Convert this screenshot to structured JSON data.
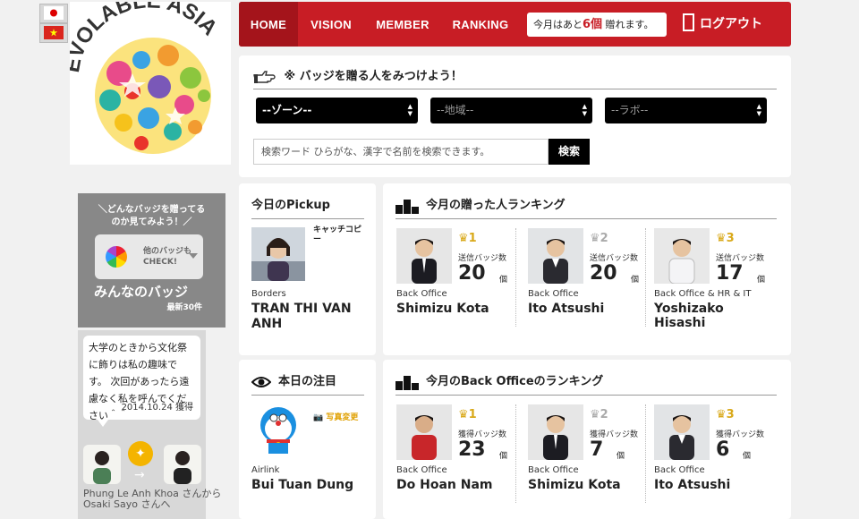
{
  "languages": [
    "Japanese",
    "Vietnamese"
  ],
  "logo": {
    "text": "EVOLABLE ASIA"
  },
  "nav": {
    "home": "HOME",
    "vision": "VISION",
    "member": "MEMBER",
    "ranking": "RANKING",
    "remain_pre": "今月はあと",
    "remain_count": "6個",
    "remain_post": " 贈れます。",
    "logout": "ログアウト"
  },
  "search": {
    "title": "※ バッジを贈る人をみつけよう！",
    "zone": "--ゾーン--",
    "area": "--地域--",
    "labo": "--ラボ--",
    "placeholder": "検索ワード ひらがな、漢字で名前を検索できます。",
    "button": "検索"
  },
  "badges_box": {
    "caption_line1": "＼どんなバッジを贈ってる",
    "caption_line2": "のか見てみよう！／",
    "check_line1": "他のバッジも",
    "check_line2": "CHECK!",
    "title": "みんなのバッジ",
    "latest": "最新30件"
  },
  "message": {
    "text": "大学のときから文化祭に飾りは私の趣味です。 次回があったら遠慮なく私を呼んでください＾＾",
    "date": "2014.10.24 獲得",
    "from_line": "Phung Le Anh Khoa さんから",
    "to_line": "Osaki Sayo さんへ"
  },
  "pickup": {
    "title": "今日のPickup",
    "catch": "キャッチコピー",
    "dept": "Borders",
    "name": "TRAN THI VAN ANH"
  },
  "attention": {
    "title": "本日の注目",
    "photo_change": "写真変更",
    "dept": "Airlink",
    "name": "Bui Tuan Dung"
  },
  "sent_ranking": {
    "title": "今月の贈った人ランキング",
    "stat_label": "送信バッジ数",
    "unit": "個",
    "entries": [
      {
        "rank": "1",
        "value": "20",
        "dept": "Back Office",
        "name": "Shimizu Kota"
      },
      {
        "rank": "2",
        "value": "20",
        "dept": "Back Office",
        "name": "Ito Atsushi"
      },
      {
        "rank": "3",
        "value": "17",
        "dept": "Back Office & HR & IT",
        "name": "Yoshizako Hisashi"
      }
    ]
  },
  "office_ranking": {
    "title": "今月のBack Officeのランキング",
    "stat_label": "獲得バッジ数",
    "unit": "個",
    "entries": [
      {
        "rank": "1",
        "value": "23",
        "dept": "Back Office",
        "name": "Do Hoan Nam"
      },
      {
        "rank": "2",
        "value": "7",
        "dept": "Back Office",
        "name": "Shimizu Kota"
      },
      {
        "rank": "3",
        "value": "6",
        "dept": "Back Office",
        "name": "Ito Atsushi"
      }
    ]
  },
  "colors": {
    "brand_red": "#c81d25",
    "gold": "#d9a91a",
    "silver": "#aaaaaa"
  }
}
